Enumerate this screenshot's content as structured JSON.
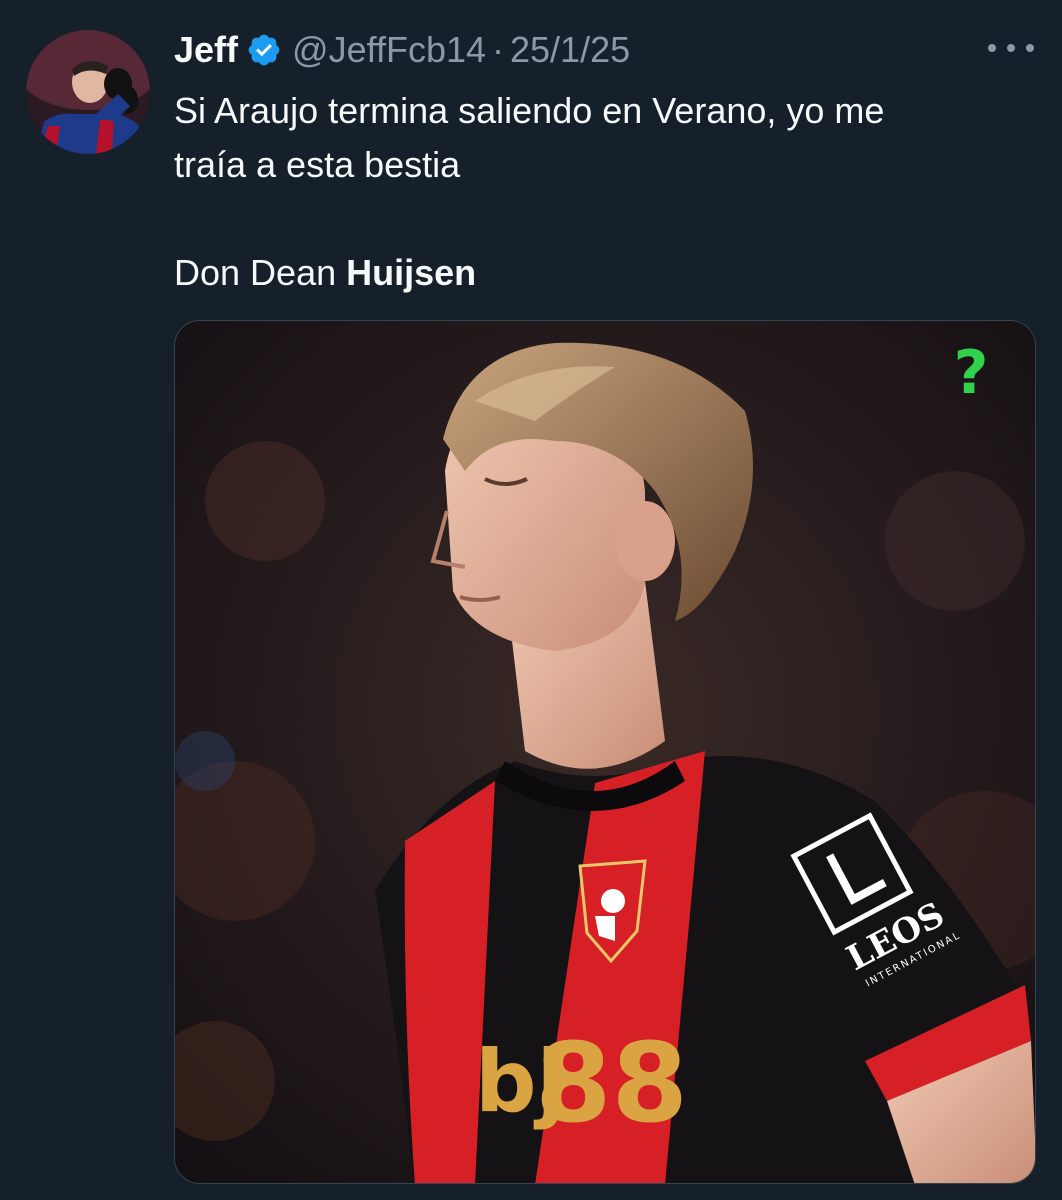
{
  "tweet": {
    "author": {
      "name": "Jeff",
      "handle": "@JeffFcb14",
      "verified": true
    },
    "separator": "·",
    "date": "25/1/25",
    "text_line1": "Si Araujo termina saliendo en Verano, yo me",
    "text_line2": "traía a esta bestia",
    "text_line3_prefix": "Don Dean ",
    "text_line3_bold": "Huijsen",
    "media": {
      "shirt_number": "88",
      "shirt_sponsor_prefix": "bj",
      "sleeve_sponsor": "LEOS",
      "sleeve_sponsor_sub": "INTERNATIONAL",
      "corner_badge": "?"
    }
  },
  "colors": {
    "background": "#15202b",
    "text_primary": "#f7f9f9",
    "text_secondary": "#8b98a5",
    "verified_blue": "#1d9bf0",
    "shirt_red": "#d71f26",
    "shirt_black": "#141214",
    "badge_green": "#2fd24a",
    "sponsor_gold": "#d9a441"
  },
  "icons": [
    "verified-badge-icon",
    "more-options-icon"
  ]
}
